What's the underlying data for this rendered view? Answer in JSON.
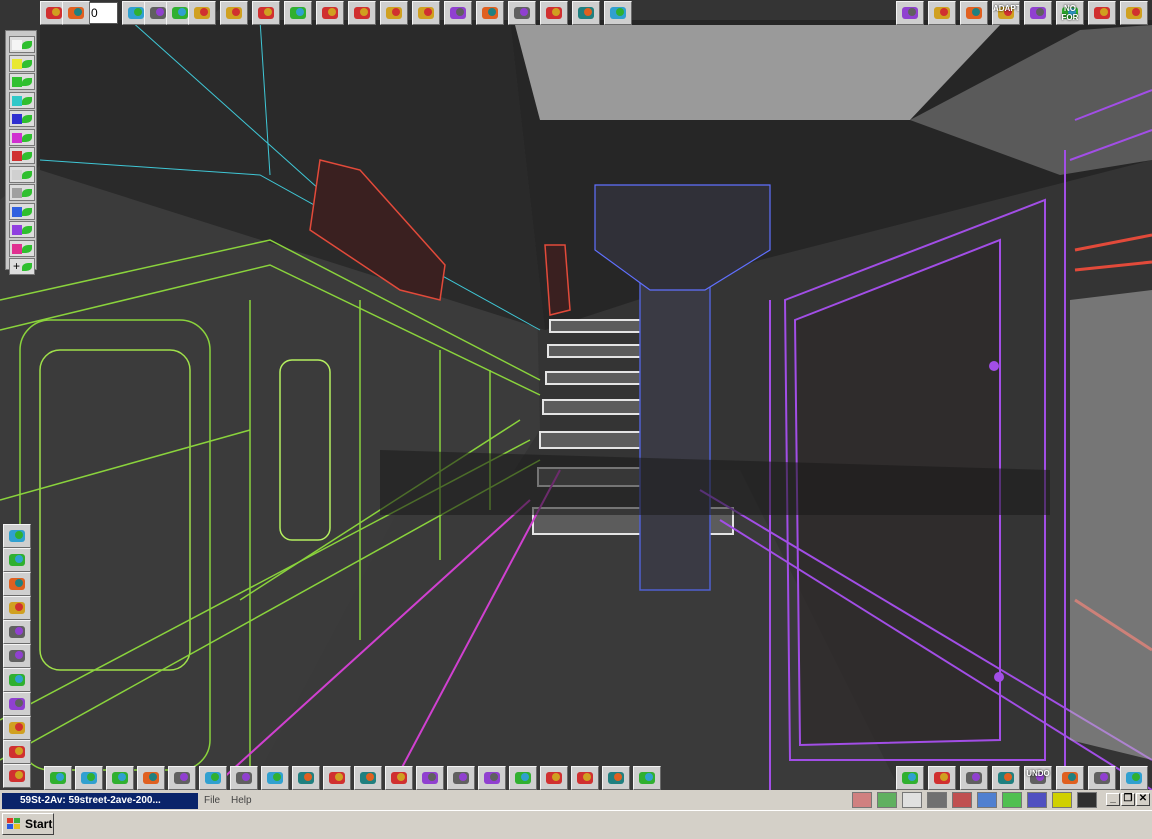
{
  "toolbar_top": {
    "frame_value": "0",
    "left_buttons": [
      "record-button",
      "rewind-to-start-button",
      "move-keyframe-button",
      "play-button",
      "forward-to-end-button",
      "key-list-button",
      "loop-button",
      "paint-bucket-button",
      "texture-button",
      "wrench-button",
      "document-button",
      "move-tool-button",
      "rotate-tool-button",
      "scale-tool-button",
      "bend-tool-button",
      "twist-tool-button",
      "taper-tool-button",
      "arrow-up-button",
      "arrow-down-button"
    ],
    "right_buttons": [
      {
        "name": "render-scene-button",
        "label": ""
      },
      {
        "name": "materials-button",
        "label": ""
      },
      {
        "name": "house-button",
        "label": ""
      },
      {
        "name": "adapt-button",
        "label": "ADAPT"
      },
      {
        "name": "eye-view-button",
        "label": ""
      },
      {
        "name": "no-for-button",
        "label": "NO FOR"
      },
      {
        "name": "color-spectrum-button",
        "label": ""
      },
      {
        "name": "light-bulb-button",
        "label": ""
      }
    ]
  },
  "object_palette": {
    "swatches": [
      "#f5f5f5",
      "#e8e830",
      "#30c030",
      "#30c8c8",
      "#3030d0",
      "#d030d0",
      "#d03030",
      "#d0d0d0",
      "#a0a0a0",
      "#3060e0",
      "#9040e0",
      "#e03090"
    ],
    "add_label": "+"
  },
  "left_vertical_tools": [
    "light-button",
    "percent-button",
    "shapes-button",
    "spheres-button",
    "gradient-button",
    "car-button",
    "globe-button",
    "landscape-button",
    "hammer-button",
    "house-tool-button",
    "recycle-button"
  ],
  "bottom_toolbar": {
    "left_buttons": [
      "box-button",
      "plane-button",
      "camera-button",
      "ribbon-button",
      "molecule-button",
      "sphere-pair-button",
      "lathe-button",
      "grid-waffle-button",
      "terrain-button",
      "blob-button",
      "cone-button",
      "palette-button",
      "spiral-button",
      "pipe-button",
      "ball-button",
      "axes-button",
      "cube-button",
      "face-button",
      "character-button",
      "3d-text-button"
    ],
    "right_buttons": [
      {
        "name": "pointer-button",
        "label": ""
      },
      {
        "name": "green-box-button",
        "label": ""
      },
      {
        "name": "grid-button",
        "label": ""
      },
      {
        "name": "page-button",
        "label": ""
      },
      {
        "name": "undo-button",
        "label": "UNDO"
      },
      {
        "name": "diamond-button",
        "label": ""
      },
      {
        "name": "play-arrow-button",
        "label": ""
      },
      {
        "name": "table-button",
        "label": ""
      }
    ]
  },
  "status_bar": {
    "document_title": "59St-2Av: 59street-2ave-200...",
    "menu_items": [
      "File",
      "Help"
    ]
  },
  "taskbar": {
    "start_label": "Start"
  },
  "colors": {
    "viewport_bg": "#343434",
    "toolbar_bg": "#cfcfcf",
    "wire_green": "#8ad33c",
    "wire_purple": "#a24ee6",
    "wire_red": "#e24a3a",
    "wire_cyan": "#3fc7d6",
    "taskbar": "#d4d0c8",
    "title_blue": "#0a246a"
  }
}
